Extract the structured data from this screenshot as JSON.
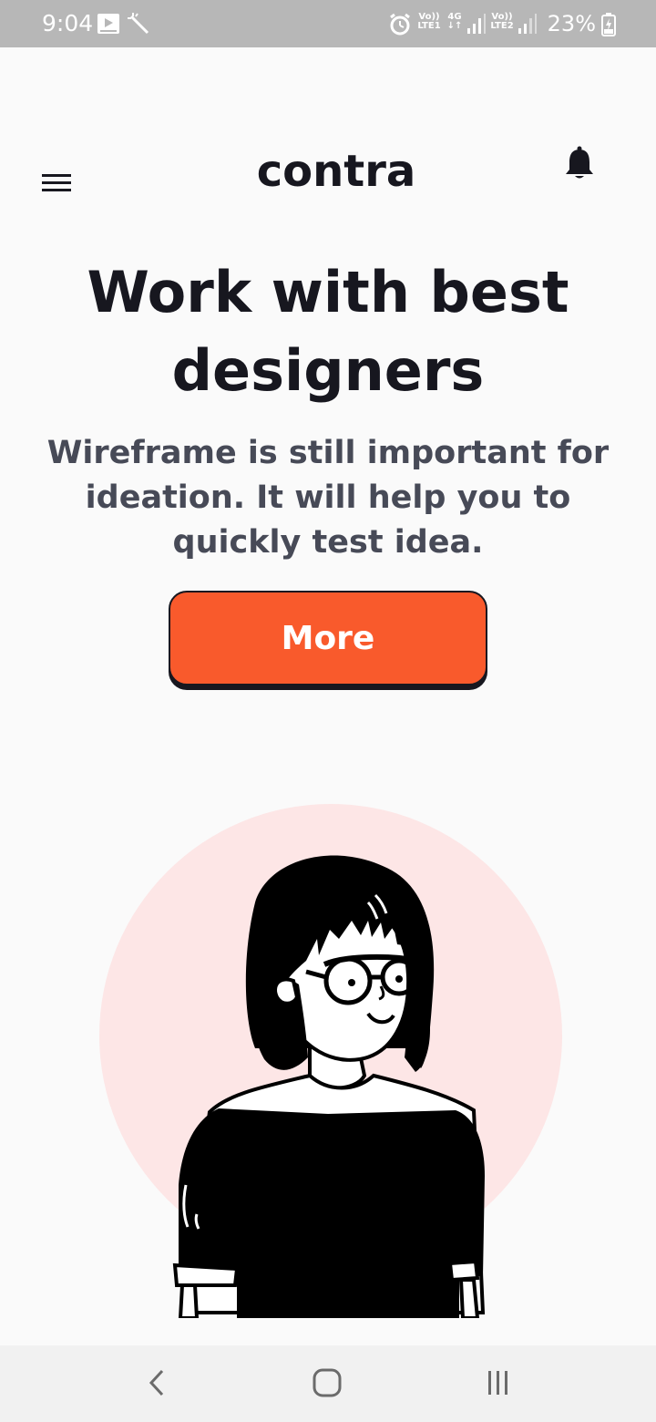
{
  "status_bar": {
    "time": "9:04",
    "battery": "23%",
    "sim1": {
      "top": "Vo))",
      "bottom": "LTE1"
    },
    "network": {
      "top": "4G",
      "bottom": "↓↑"
    },
    "sim2": {
      "top": "Vo))",
      "bottom": "LTE2"
    }
  },
  "header": {
    "logo": "contra",
    "menu_icon": "hamburger-menu-icon",
    "bell_icon": "bell-icon"
  },
  "hero": {
    "title_line1": "Work with best",
    "title_line2": "designers",
    "subtitle_line1": "Wireframe is still important for",
    "subtitle_line2": "ideation. It will help you to",
    "subtitle_line3": "quickly test idea.",
    "button_label": "More"
  },
  "colors": {
    "accent": "#f95a2c",
    "text_primary": "#17171f",
    "text_secondary": "#474a57",
    "illustration_bg": "#fde6e6"
  },
  "nav_bar": {
    "back_icon": "back-chevron-icon",
    "home_icon": "home-icon",
    "recents_icon": "recents-icon"
  }
}
